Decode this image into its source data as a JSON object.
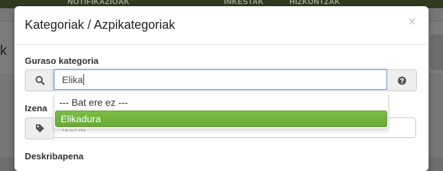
{
  "background": {
    "nav_items": [
      "NOTIFIKAZIOAK",
      "INKESTAK",
      "HIZKUNTZAK"
    ],
    "left_fragment": "k"
  },
  "modal": {
    "title": "Kategoriak / Azpikategoriak",
    "close_glyph": "×",
    "parent_category": {
      "label": "Guraso kategoria",
      "value": "Elika",
      "icon": "search-icon",
      "help_icon": "question-circle-icon"
    },
    "dropdown": {
      "options": [
        "--- Bat ere ez ---",
        "Elikadura"
      ],
      "highlighted_index": 1
    },
    "name": {
      "label": "Izena",
      "placeholder": "Izena",
      "icon": "tag-icon"
    },
    "description": {
      "label": "Deskribapena"
    }
  },
  "colors": {
    "accent_green": "#71b33f",
    "focus_blue": "#5e94c8",
    "topbar": "#2f3a1f"
  }
}
